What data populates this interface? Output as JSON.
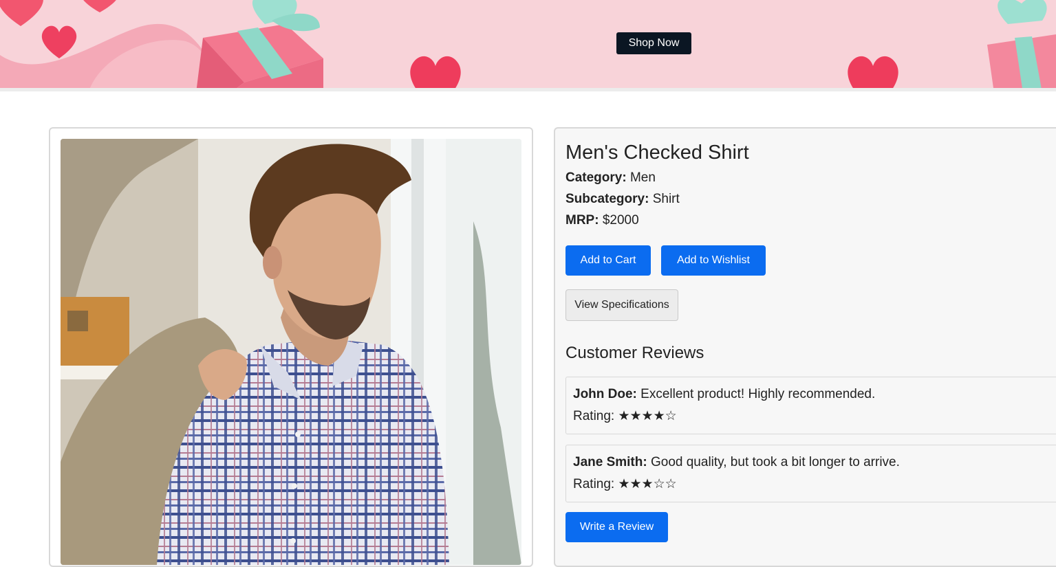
{
  "banner": {
    "cta_label": "Shop Now",
    "background_color": "#f8d3d9",
    "cta_color": "#0b1623"
  },
  "product": {
    "title": "Men's Checked Shirt",
    "category_label": "Category:",
    "category_value": "Men",
    "subcategory_label": "Subcategory:",
    "subcategory_value": "Shirt",
    "mrp_label": "MRP:",
    "mrp_value": "$2000",
    "image_alt": "Man wearing a checked shirt"
  },
  "actions": {
    "add_to_cart": "Add to Cart",
    "add_to_wishlist": "Add to Wishlist",
    "view_specifications": "View Specifications",
    "write_review": "Write a Review",
    "primary_color": "#0b6cf0"
  },
  "reviews": {
    "heading": "Customer Reviews",
    "rating_label": "Rating:",
    "items": [
      {
        "author": "John Doe:",
        "text": "Excellent product! Highly recommended.",
        "stars": "★★★★☆",
        "rating": 4
      },
      {
        "author": "Jane Smith:",
        "text": "Good quality, but took a bit longer to arrive.",
        "stars": "★★★☆☆",
        "rating": 3
      }
    ]
  }
}
